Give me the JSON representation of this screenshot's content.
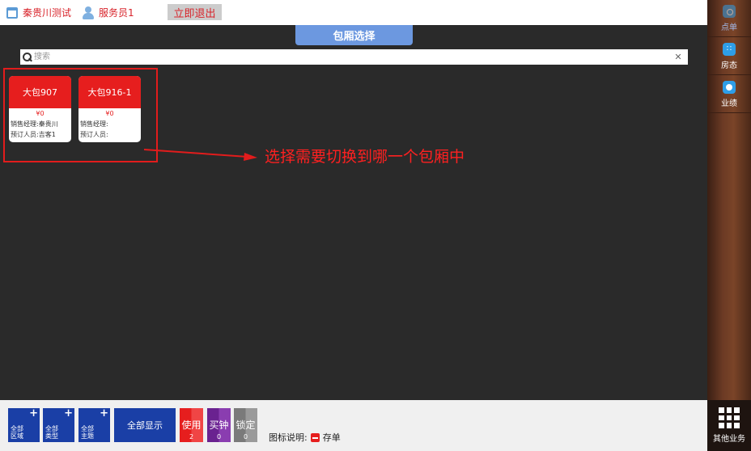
{
  "topbar": {
    "store_name": "秦贵川测试",
    "user_name": "服务员1",
    "logout_label": "立即退出"
  },
  "main": {
    "room_select_label": "包厢选择",
    "search": {
      "placeholder": "搜索",
      "clear_icon": "close-icon"
    },
    "rooms": [
      {
        "name": "大包907",
        "price": "¥0",
        "manager_label": "销售经理:",
        "manager": "秦贵川",
        "booker_label": "预订人员:",
        "booker": "吉客1"
      },
      {
        "name": "大包916-1",
        "price": "¥0",
        "manager_label": "销售经理:",
        "manager": "",
        "booker_label": "预订人员:",
        "booker": ""
      }
    ],
    "annotation": "选择需要切换到哪一个包厢中"
  },
  "bottombar": {
    "filters": [
      {
        "label": "全部\n区域"
      },
      {
        "label": "全部\n类型"
      },
      {
        "label": "全部\n主题"
      }
    ],
    "show_all_label": "全部显示",
    "statuses": [
      {
        "label": "使用",
        "count": "2",
        "color": "#e61e1e"
      },
      {
        "label": "买钟",
        "count": "0",
        "color": "#7b2d9e"
      },
      {
        "label": "锁定",
        "count": "0",
        "color": "#8a8a8a"
      }
    ],
    "legend_label": "图标说明:",
    "legend_item": "存单"
  },
  "sidebar": {
    "items": [
      {
        "label": "点单",
        "icon": "share-icon"
      },
      {
        "label": "房态",
        "icon": "dots-icon"
      },
      {
        "label": "业绩",
        "icon": "pie-icon"
      }
    ],
    "other_label": "其他业务"
  },
  "colors": {
    "accent_red": "#e61e1e",
    "accent_blue": "#1a3fa6",
    "select_blue": "#6c98e0"
  }
}
